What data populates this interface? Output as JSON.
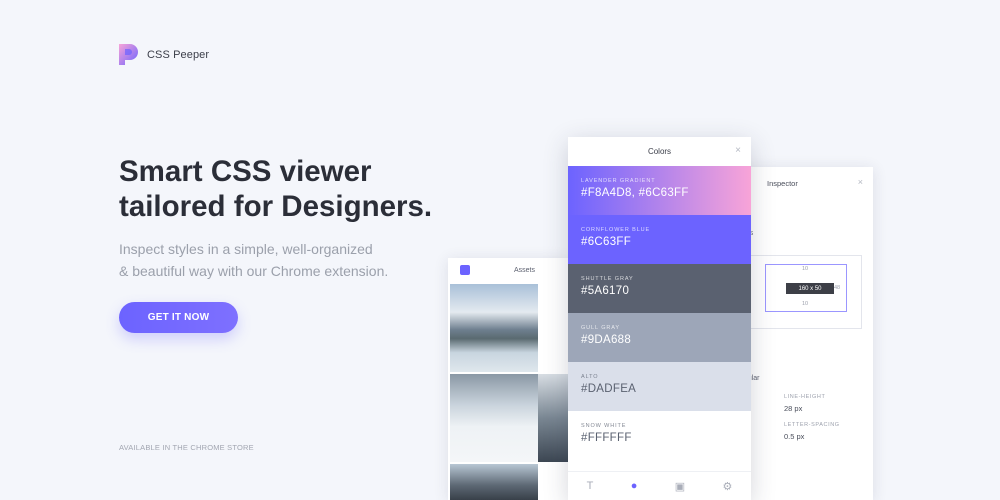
{
  "brand": {
    "name": "CSS Peeper"
  },
  "hero": {
    "headline_line1": "Smart CSS viewer",
    "headline_line2": "tailored for Designers.",
    "subtitle_line1": "Inspect styles in a simple, well-organized",
    "subtitle_line2": "& beautiful way with our Chrome extension.",
    "cta_label": "GET IT NOW",
    "store_note": "AVAILABLE IN THE CHROME STORE"
  },
  "assets_panel": {
    "title": "Assets"
  },
  "inspector_panel": {
    "title": "Inspector",
    "close": "×",
    "section_label": "rties",
    "box_content": "160 x 50",
    "box_top": "10",
    "box_bottom": "10",
    "box_right": "48",
    "font_style": "egular",
    "line_height_label": "LINE-HEIGHT",
    "line_height_value": "28 px",
    "letter_spacing_label": "LETTER-SPACING",
    "letter_spacing_value": "0.5 px"
  },
  "colors_panel": {
    "title": "Colors",
    "close": "×",
    "swatches": [
      {
        "name": "Lavender gradient",
        "code": "#F8A4D8, #6C63FF",
        "bg": "linear-gradient(90deg,#6c63ff,#f8a4d8)",
        "text": "#ffffff"
      },
      {
        "name": "Cornflower blue",
        "code": "#6C63FF",
        "bg": "#6c63ff",
        "text": "#ffffff"
      },
      {
        "name": "Shuttle gray",
        "code": "#5A6170",
        "bg": "#5a6170",
        "text": "#ffffff"
      },
      {
        "name": "Gull gray",
        "code": "#9DA688",
        "bg": "#9da6b8",
        "text": "#ffffff"
      },
      {
        "name": "Alto",
        "code": "#DADFEA",
        "bg": "#dadfea",
        "text": "#5a6170"
      },
      {
        "name": "Snow white",
        "code": "#FFFFFF",
        "bg": "#ffffff",
        "text": "#5a6170"
      }
    ],
    "bottom_icons": [
      "text-icon",
      "drop-icon",
      "camera-icon",
      "gear-icon"
    ]
  },
  "colors": {
    "accent": "#6c63ff",
    "background": "#f4f6fb"
  }
}
